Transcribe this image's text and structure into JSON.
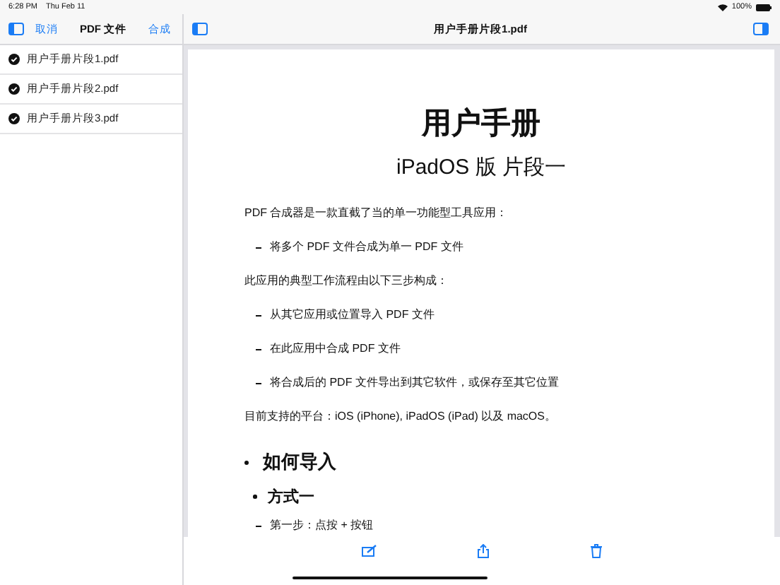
{
  "status_bar": {
    "time": "6:28 PM",
    "date": "Thu Feb 11",
    "battery": "100%"
  },
  "sidebar": {
    "cancel": "取消",
    "title": "PDF 文件",
    "merge": "合成",
    "files": [
      {
        "name": "用户手册片段1.pdf",
        "checked": true
      },
      {
        "name": "用户手册片段2.pdf",
        "checked": true
      },
      {
        "name": "用户手册片段3.pdf",
        "checked": true
      }
    ]
  },
  "viewer": {
    "title": "用户手册片段1.pdf"
  },
  "document": {
    "title": "用户手册",
    "subtitle": "iPadOS 版 片段一",
    "blocks": [
      {
        "kind": "paragraph",
        "text": "PDF 合成器是一款直截了当的单一功能型工具应用："
      },
      {
        "kind": "dash",
        "text": "将多个 PDF 文件合成为单一 PDF 文件"
      },
      {
        "kind": "paragraph",
        "text": "此应用的典型工作流程由以下三步构成："
      },
      {
        "kind": "dash",
        "text": "从其它应用或位置导入 PDF 文件"
      },
      {
        "kind": "dash",
        "text": "在此应用中合成 PDF 文件"
      },
      {
        "kind": "dash",
        "text": "将合成后的 PDF 文件导出到其它软件，或保存至其它位置"
      },
      {
        "kind": "paragraph",
        "text": "目前支持的平台：iOS (iPhone), iPadOS (iPad) 以及 macOS。"
      },
      {
        "kind": "heading1",
        "text": "如何导入"
      },
      {
        "kind": "heading2",
        "text": "方式一"
      },
      {
        "kind": "dash",
        "text": "第一步：点按 + 按钮"
      }
    ]
  }
}
